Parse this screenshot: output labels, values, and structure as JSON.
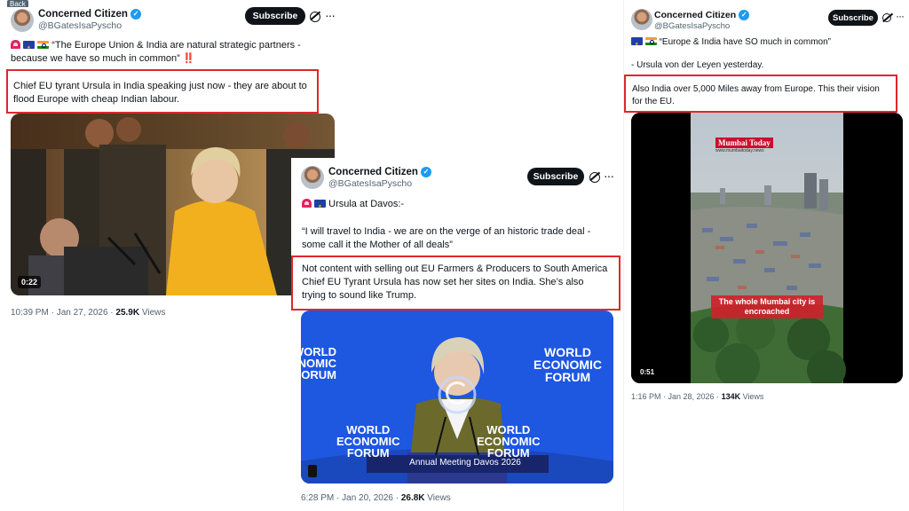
{
  "back_label": "Back",
  "tweet1": {
    "name": "Concerned Citizen",
    "handle": "@BGatesIsaPyscho",
    "subscribe": "Subscribe",
    "quote": "“The Europe Union & India are natural strategic partners - because we have so much in common”",
    "bangs": "‼️",
    "highlight": "Chief EU tyrant Ursula in India speaking just now - they are about to flood Europe with cheap Indian labour.",
    "video_time": "0:22",
    "timestamp": "10:39 PM · Jan 27, 2026 · ",
    "views_count": "25.9K",
    "views_label": " Views"
  },
  "tweet2": {
    "name": "Concerned Citizen",
    "handle": "@BGatesIsaPyscho",
    "subscribe": "Subscribe",
    "intro": "Ursula at Davos:-",
    "quote": "“I will travel to India - we are on the verge of an historic trade deal - some call it the Mother of all deals”",
    "highlight": "Not content with selling out EU Farmers & Producers to South America Chief EU Tyrant Ursula has now set her sites on India.  She’s also trying to sound like Trump.",
    "wef_left": "WORLD\nECONOMIC\nFORUM",
    "wef_right": "WORLD\nECONOMIC\nFORUM",
    "podium": "Annual Meeting Davos 2026",
    "timestamp": "6:28 PM · Jan 20, 2026 · ",
    "views_count": "26.8K",
    "views_label": " Views"
  },
  "tweet3": {
    "name": "Concerned Citizen",
    "handle": "@BGatesIsaPyscho",
    "subscribe": "Subscribe",
    "quote": "“Europe & India have SO much in common”",
    "attribution": "- Ursula von der Leyen yesterday.",
    "highlight": "Also India over 5,000 Miles away from Europe.  This their vision for the EU.",
    "logo": "Mumbai Today",
    "logo_sub": "www.mumbaitoday.news",
    "caption": "The whole Mumbai city is encroached",
    "video_time": "0:51",
    "timestamp": "1:16 PM · Jan 28, 2026 · ",
    "views_count": "134K",
    "views_label": " Views"
  },
  "colors": {
    "verified": "#1d9bf0",
    "highlight_border": "#e0262d",
    "wef_blue": "#1a4fd6",
    "caption_red": "#d0202a"
  },
  "icons": [
    "verified-badge-icon",
    "grok-icon",
    "more-icon",
    "siren-emoji-icon",
    "eu-flag-icon",
    "india-flag-icon",
    "play-spinner-icon"
  ]
}
